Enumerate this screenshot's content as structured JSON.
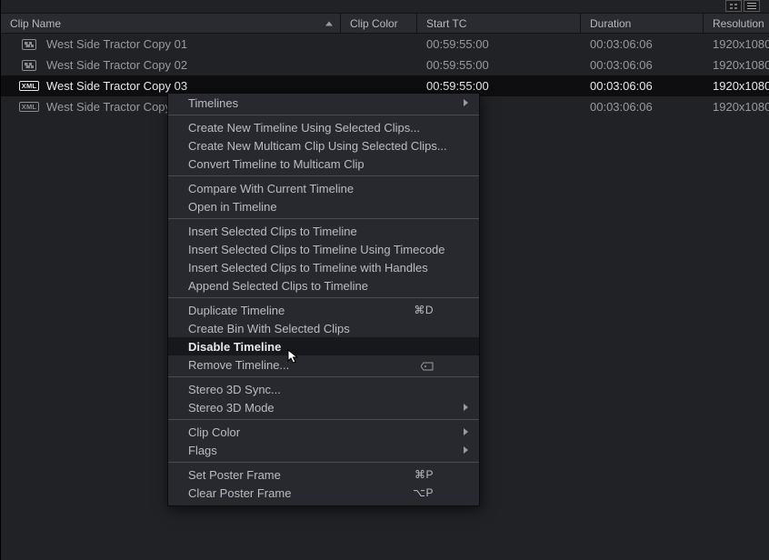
{
  "columns": {
    "name": "Clip Name",
    "color": "Clip Color",
    "start": "Start TC",
    "dur": "Duration",
    "res": "Resolution"
  },
  "rows": [
    {
      "type": "timeline",
      "name": "West Side Tractor Copy 01",
      "start": "00:59:55:00",
      "dur": "00:03:06:06",
      "res": "1920x1080",
      "selected": false
    },
    {
      "type": "timeline",
      "name": "West Side Tractor Copy 02",
      "start": "00:59:55:00",
      "dur": "00:03:06:06",
      "res": "1920x1080",
      "selected": false
    },
    {
      "type": "xml",
      "name": "West Side Tractor Copy 03",
      "start": "00:59:55:00",
      "dur": "00:03:06:06",
      "res": "1920x1080",
      "selected": true
    },
    {
      "type": "xml",
      "name": "West Side Tractor Copy",
      "start": "",
      "dur": "00:03:06:06",
      "res": "1920x1080",
      "selected": false
    }
  ],
  "xml_badge": "XML",
  "menu": {
    "timelines": "Timelines",
    "createTimeline": "Create New Timeline Using Selected Clips...",
    "createMulticam": "Create New Multicam Clip Using Selected Clips...",
    "convertMulticam": "Convert Timeline to Multicam Clip",
    "compare": "Compare With Current Timeline",
    "open": "Open in Timeline",
    "insert": "Insert Selected Clips to Timeline",
    "insertTC": "Insert Selected Clips to Timeline Using Timecode",
    "insertHandles": "Insert Selected Clips to Timeline with Handles",
    "append": "Append Selected Clips to Timeline",
    "duplicate": "Duplicate Timeline",
    "createBin": "Create Bin With Selected Clips",
    "disable": "Disable Timeline",
    "remove": "Remove Timeline...",
    "stereoSync": "Stereo 3D Sync...",
    "stereoMode": "Stereo 3D Mode",
    "clipColor": "Clip Color",
    "flags": "Flags",
    "setPoster": "Set Poster Frame",
    "clearPoster": "Clear Poster Frame"
  },
  "shortcuts": {
    "duplicate": "⌘D",
    "setPoster": "⌘P",
    "clearPoster": "⌥P"
  },
  "icons": {
    "thumbnail_view": "thumbnail-view-icon",
    "list_view": "list-view-icon",
    "sort_asc": "sort-ascending-icon"
  }
}
